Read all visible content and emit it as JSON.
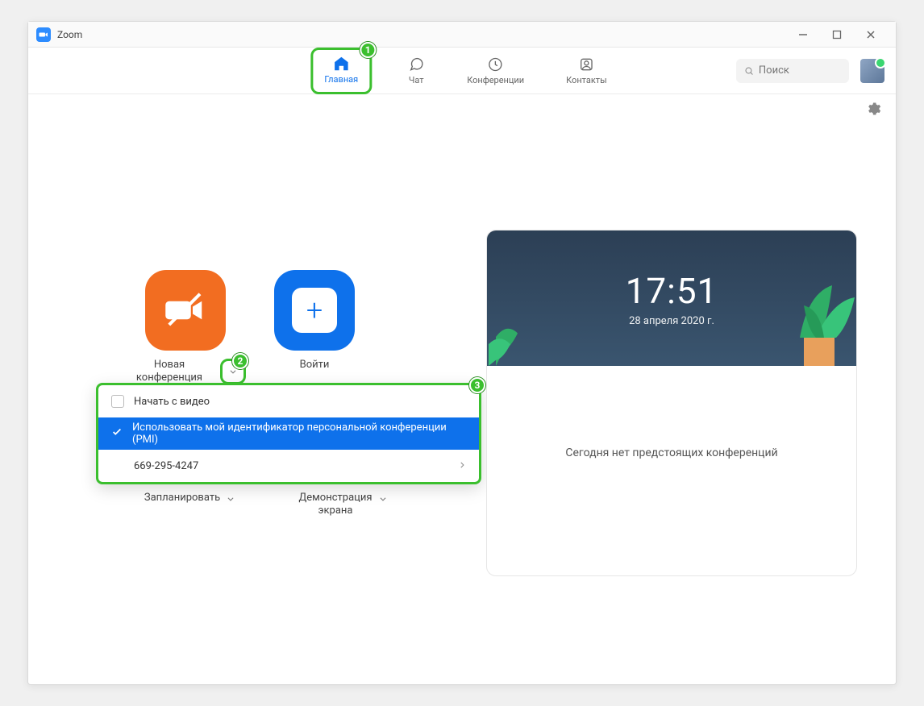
{
  "window_title": "Zoom",
  "nav": {
    "home": "Главная",
    "chat": "Чат",
    "meetings": "Конференции",
    "contacts": "Контакты"
  },
  "search": {
    "placeholder": "Поиск"
  },
  "actions": {
    "new_meeting": "Новая конференция",
    "join": "Войти",
    "schedule": "Запланировать",
    "share": "Демонстрация",
    "share_line2": "экрана"
  },
  "dropdown": {
    "start_with_video": "Начать с видео",
    "use_pmi": "Использовать мой идентификатор персональной конференции (PMI)",
    "pmi_value": "669-295-4247"
  },
  "calendar": {
    "time": "17:51",
    "date": "28 апреля 2020 г.",
    "empty_text": "Сегодня нет предстоящих конференций"
  },
  "annotations": {
    "b1": "1",
    "b2": "2",
    "b3": "3"
  }
}
